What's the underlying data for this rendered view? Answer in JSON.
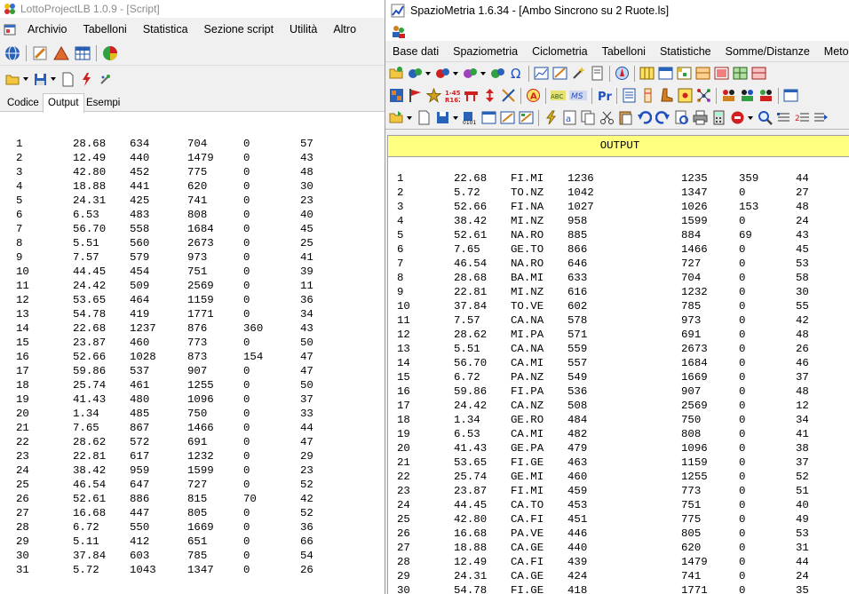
{
  "left_window": {
    "title": "LottoProjectLB 1.0.9 - [Script]",
    "menu": [
      "Archivio",
      "Tabelloni",
      "Statistica",
      "Sezione script",
      "Utilità",
      "Altro"
    ],
    "toolbar1_icons": [
      "globe-icon",
      "edit-pencil-icon",
      "triangle-icon",
      "table-grid-icon",
      "pie-chart-icon"
    ],
    "toolbar2_icons": [
      "open-folder-icon",
      "save-icon",
      "new-document-icon",
      "run-script-icon",
      "tools-icon"
    ],
    "tabs": [
      "Codice",
      "Output",
      "Esempi"
    ],
    "active_tab": "Output",
    "rows": [
      [
        "1",
        "28.68",
        "634",
        "704",
        "0",
        "57"
      ],
      [
        "2",
        "12.49",
        "440",
        "1479",
        "0",
        "43"
      ],
      [
        "3",
        "42.80",
        "452",
        "775",
        "0",
        "48"
      ],
      [
        "4",
        "18.88",
        "441",
        "620",
        "0",
        "30"
      ],
      [
        "5",
        "24.31",
        "425",
        "741",
        "0",
        "23"
      ],
      [
        "6",
        "6.53",
        "483",
        "808",
        "0",
        "40"
      ],
      [
        "7",
        "56.70",
        "558",
        "1684",
        "0",
        "45"
      ],
      [
        "8",
        "5.51",
        "560",
        "2673",
        "0",
        "25"
      ],
      [
        "9",
        "7.57",
        "579",
        "973",
        "0",
        "41"
      ],
      [
        "10",
        "44.45",
        "454",
        "751",
        "0",
        "39"
      ],
      [
        "11",
        "24.42",
        "509",
        "2569",
        "0",
        "11"
      ],
      [
        "12",
        "53.65",
        "464",
        "1159",
        "0",
        "36"
      ],
      [
        "13",
        "54.78",
        "419",
        "1771",
        "0",
        "34"
      ],
      [
        "14",
        "22.68",
        "1237",
        "876",
        "360",
        "43"
      ],
      [
        "15",
        "23.87",
        "460",
        "773",
        "0",
        "50"
      ],
      [
        "16",
        "52.66",
        "1028",
        "873",
        "154",
        "47"
      ],
      [
        "17",
        "59.86",
        "537",
        "907",
        "0",
        "47"
      ],
      [
        "18",
        "25.74",
        "461",
        "1255",
        "0",
        "50"
      ],
      [
        "19",
        "41.43",
        "480",
        "1096",
        "0",
        "37"
      ],
      [
        "20",
        "1.34",
        "485",
        "750",
        "0",
        "33"
      ],
      [
        "21",
        "7.65",
        "867",
        "1466",
        "0",
        "44"
      ],
      [
        "22",
        "28.62",
        "572",
        "691",
        "0",
        "47"
      ],
      [
        "23",
        "22.81",
        "617",
        "1232",
        "0",
        "29"
      ],
      [
        "24",
        "38.42",
        "959",
        "1599",
        "0",
        "23"
      ],
      [
        "25",
        "46.54",
        "647",
        "727",
        "0",
        "52"
      ],
      [
        "26",
        "52.61",
        "886",
        "815",
        "70",
        "42"
      ],
      [
        "27",
        "16.68",
        "447",
        "805",
        "0",
        "52"
      ],
      [
        "28",
        "6.72",
        "550",
        "1669",
        "0",
        "36"
      ],
      [
        "29",
        "5.11",
        "412",
        "651",
        "0",
        "66"
      ],
      [
        "30",
        "37.84",
        "603",
        "785",
        "0",
        "54"
      ],
      [
        "31",
        "5.72",
        "1043",
        "1347",
        "0",
        "26"
      ]
    ]
  },
  "right_window": {
    "title": "SpazioMetria  1.6.34 - [Ambo Sincrono su 2 Ruote.ls]",
    "menu": [
      "Base dati",
      "Spaziometria",
      "Ciclometria",
      "Tabelloni",
      "Statistiche",
      "Somme/Distanze",
      "Metodi"
    ],
    "output_header": "OUTPUT",
    "accent_color": "#ffff80",
    "rows": [
      [
        "1",
        "22.68",
        "FI.MI",
        "1236",
        "1235",
        "359",
        "44"
      ],
      [
        "2",
        "5.72",
        "TO.NZ",
        "1042",
        "1347",
        "0",
        "27"
      ],
      [
        "3",
        "52.66",
        "FI.NA",
        "1027",
        "1026",
        "153",
        "48"
      ],
      [
        "4",
        "38.42",
        "MI.NZ",
        "958",
        "1599",
        "0",
        "24"
      ],
      [
        "5",
        "52.61",
        "NA.RO",
        "885",
        "884",
        "69",
        "43"
      ],
      [
        "6",
        "7.65",
        "GE.TO",
        "866",
        "1466",
        "0",
        "45"
      ],
      [
        "7",
        "46.54",
        "NA.RO",
        "646",
        "727",
        "0",
        "53"
      ],
      [
        "8",
        "28.68",
        "BA.MI",
        "633",
        "704",
        "0",
        "58"
      ],
      [
        "9",
        "22.81",
        "MI.NZ",
        "616",
        "1232",
        "0",
        "30"
      ],
      [
        "10",
        "37.84",
        "TO.VE",
        "602",
        "785",
        "0",
        "55"
      ],
      [
        "11",
        "7.57",
        "CA.NA",
        "578",
        "973",
        "0",
        "42"
      ],
      [
        "12",
        "28.62",
        "MI.PA",
        "571",
        "691",
        "0",
        "48"
      ],
      [
        "13",
        "5.51",
        "CA.NA",
        "559",
        "2673",
        "0",
        "26"
      ],
      [
        "14",
        "56.70",
        "CA.MI",
        "557",
        "1684",
        "0",
        "46"
      ],
      [
        "15",
        "6.72",
        "PA.NZ",
        "549",
        "1669",
        "0",
        "37"
      ],
      [
        "16",
        "59.86",
        "FI.PA",
        "536",
        "907",
        "0",
        "48"
      ],
      [
        "17",
        "24.42",
        "CA.NZ",
        "508",
        "2569",
        "0",
        "12"
      ],
      [
        "18",
        "1.34",
        "GE.RO",
        "484",
        "750",
        "0",
        "34"
      ],
      [
        "19",
        "6.53",
        "CA.MI",
        "482",
        "808",
        "0",
        "41"
      ],
      [
        "20",
        "41.43",
        "GE.PA",
        "479",
        "1096",
        "0",
        "38"
      ],
      [
        "21",
        "53.65",
        "FI.GE",
        "463",
        "1159",
        "0",
        "37"
      ],
      [
        "22",
        "25.74",
        "GE.MI",
        "460",
        "1255",
        "0",
        "52"
      ],
      [
        "23",
        "23.87",
        "FI.MI",
        "459",
        "773",
        "0",
        "51"
      ],
      [
        "24",
        "44.45",
        "CA.TO",
        "453",
        "751",
        "0",
        "40"
      ],
      [
        "25",
        "42.80",
        "CA.FI",
        "451",
        "775",
        "0",
        "49"
      ],
      [
        "26",
        "16.68",
        "PA.VE",
        "446",
        "805",
        "0",
        "53"
      ],
      [
        "27",
        "18.88",
        "CA.GE",
        "440",
        "620",
        "0",
        "31"
      ],
      [
        "28",
        "12.49",
        "CA.FI",
        "439",
        "1479",
        "0",
        "44"
      ],
      [
        "29",
        "24.31",
        "CA.GE",
        "424",
        "741",
        "0",
        "24"
      ],
      [
        "30",
        "54.78",
        "FI.GE",
        "418",
        "1771",
        "0",
        "35"
      ]
    ]
  }
}
